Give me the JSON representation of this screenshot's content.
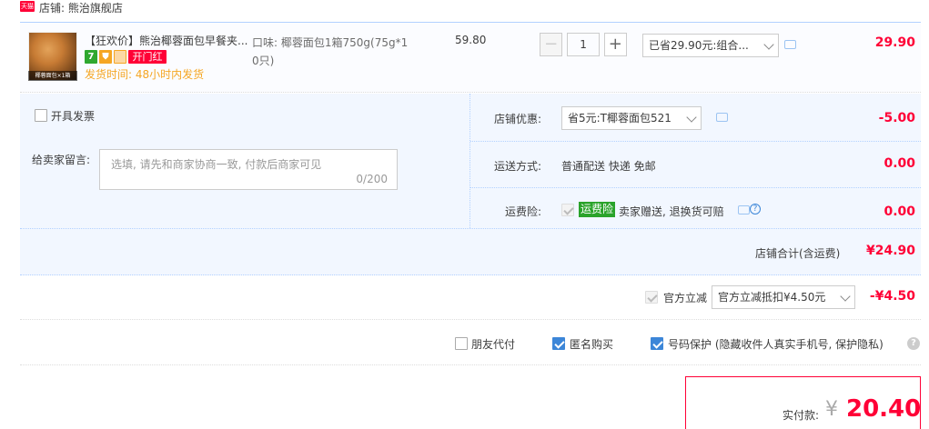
{
  "shop": {
    "badge": "天猫",
    "name": "店铺: 熊治旗舰店"
  },
  "item": {
    "thumb_caption": "椰蓉面包×1箱",
    "title": "【狂欢价】熊治椰蓉面包早餐夹...",
    "tags": [
      "7",
      "",
      "",
      "开门红"
    ],
    "ship_time": "发货时间: 48小时内发货",
    "sku_line1": "口味: 椰蓉面包1箱750g(75g*1",
    "sku_line2": "0只)",
    "price": "59.80",
    "qty_minus": "−",
    "qty_value": "1",
    "qty_plus": "+",
    "discount_select": "已省29.90元:组合...",
    "subtotal": "29.90"
  },
  "invoice": {
    "label": "开具发票"
  },
  "message": {
    "label": "给卖家留言:",
    "placeholder": "选填, 请先和商家协商一致, 付款后商家可见",
    "counter": "0/200"
  },
  "shop_discount": {
    "label": "店铺优惠:",
    "select": "省5元:T椰蓉面包521",
    "amount": "-5.00"
  },
  "shipping": {
    "label": "运送方式:",
    "value": "普通配送 快递 免邮",
    "amount": "0.00"
  },
  "insurance": {
    "label": "运费险:",
    "tag": "运费险",
    "value": "卖家赠送, 退换货可赔",
    "amount": "0.00"
  },
  "shop_total": {
    "label": "店铺合计(含运费)",
    "amount": "¥24.90"
  },
  "official": {
    "label": "官方立减",
    "select": "官方立减抵扣¥4.50元",
    "amount": "-¥4.50"
  },
  "options": {
    "friend_pay": "朋友代付",
    "anonymous": "匿名购买",
    "number_protect": "号码保护 (隐藏收件人真实手机号, 保护隐私)",
    "help": "?"
  },
  "payment": {
    "label": "实付款:",
    "currency": "¥",
    "amount": "20.40"
  },
  "colors": {
    "accent_red": "#ff0036",
    "accent_blue": "#3c86d8",
    "ship_orange": "#f5a623",
    "panel_bg": "#f2f7ff"
  }
}
